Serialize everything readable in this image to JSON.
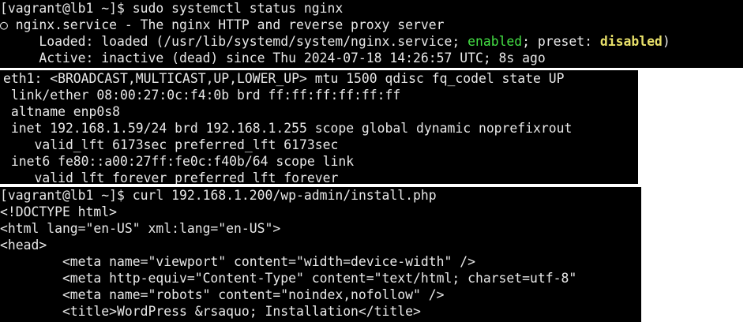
{
  "colors": {
    "background": "#000000",
    "text": "#e8e8e8",
    "enabled": "#44e044",
    "disabled": "#e8e06a"
  },
  "status_panel": {
    "prompt": "[vagrant@lb1 ~]$ ",
    "command": "sudo systemctl status nginx",
    "service_line": "○ nginx.service - The nginx HTTP and reverse proxy server",
    "loaded_prefix": "     Loaded: loaded (/usr/lib/systemd/system/nginx.service; ",
    "loaded_enabled": "enabled",
    "loaded_mid": "; preset: ",
    "loaded_preset": "disabled",
    "loaded_suffix": ")",
    "active_line": "     Active: inactive (dead) since Thu 2024-07-18 14:26:57 UTC; 8s ago"
  },
  "iface_panel": {
    "lines": [
      "eth1: <BROADCAST,MULTICAST,UP,LOWER_UP> mtu 1500 qdisc fq_codel state UP",
      " link/ether 08:00:27:0c:f4:0b brd ff:ff:ff:ff:ff:ff",
      " altname enp0s8",
      " inet 192.168.1.59/24 brd 192.168.1.255 scope global dynamic noprefixrout",
      "    valid_lft 6173sec preferred_lft 6173sec",
      " inet6 fe80::a00:27ff:fe0c:f40b/64 scope link",
      "    valid_lft forever preferred_lft forever"
    ]
  },
  "curl_panel": {
    "prompt": "[vagrant@lb1 ~]$ ",
    "command": "curl 192.168.1.200/wp-admin/install.php",
    "output": [
      "<!DOCTYPE html>",
      "<html lang=\"en-US\" xml:lang=\"en-US\">",
      "<head>",
      "        <meta name=\"viewport\" content=\"width=device-width\" />",
      "        <meta http-equiv=\"Content-Type\" content=\"text/html; charset=utf-8\"",
      "        <meta name=\"robots\" content=\"noindex,nofollow\" />",
      "        <title>WordPress &rsaquo; Installation</title>"
    ]
  }
}
